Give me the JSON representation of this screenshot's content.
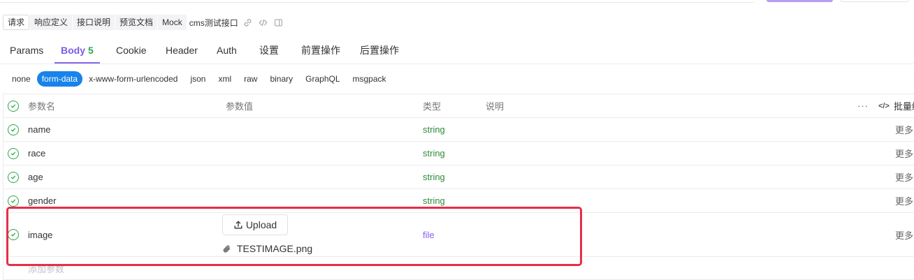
{
  "subtabs": [
    "请求",
    "响应定义",
    "接口说明",
    "预览文档",
    "Mock"
  ],
  "api_name": "cms测试接口",
  "tabs": {
    "params": "Params",
    "body": "Body",
    "body_count": "5",
    "cookie": "Cookie",
    "header": "Header",
    "auth": "Auth",
    "settings": "设置",
    "pre": "前置操作",
    "post": "后置操作"
  },
  "body_types": [
    "none",
    "form-data",
    "x-www-form-urlencoded",
    "json",
    "xml",
    "raw",
    "binary",
    "GraphQL",
    "msgpack"
  ],
  "table": {
    "headers": {
      "name": "参数名",
      "value": "参数值",
      "type": "类型",
      "desc": "说明",
      "dots": "···",
      "code": "</>",
      "batch": "批量编"
    },
    "rows": [
      {
        "name": "name",
        "type": "string",
        "more": "更多"
      },
      {
        "name": "race",
        "type": "string",
        "more": "更多"
      },
      {
        "name": "age",
        "type": "string",
        "more": "更多"
      },
      {
        "name": "gender",
        "type": "string",
        "more": "更多"
      },
      {
        "name": "image",
        "type": "file",
        "more": "更多",
        "upload_label": "Upload",
        "file_name": "TESTIMAGE.png"
      }
    ],
    "add_param": "添加参数"
  },
  "colors": {
    "accent": "#8466e8",
    "active_type": "#1883ea",
    "string_type": "#2e8c3a",
    "file_type": "#8b5cf6",
    "check": "#2aa84a",
    "highlight": "#e62e48"
  }
}
